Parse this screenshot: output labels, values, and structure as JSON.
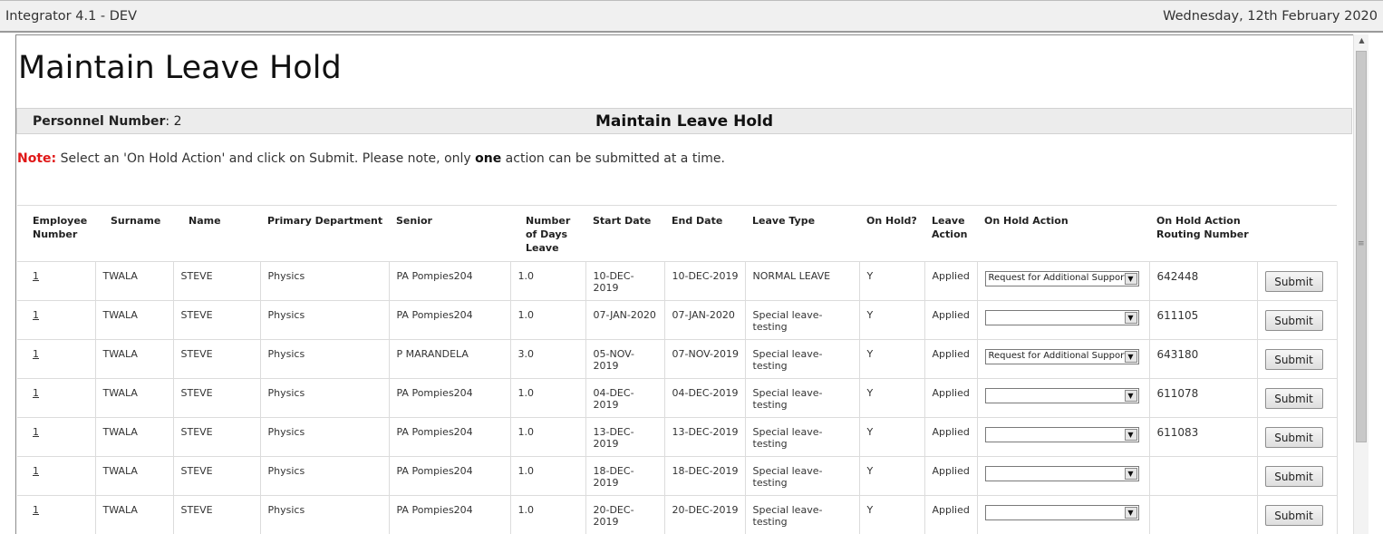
{
  "window": {
    "app_title": "Integrator 4.1 - DEV",
    "date": "Wednesday, 12th February 2020"
  },
  "page": {
    "title": "Maintain Leave Hold",
    "personnel_label": "Personnel Number",
    "personnel_value": ": 2",
    "section_title": "Maintain Leave Hold",
    "note_label": "Note:",
    "note_text_1": " Select an 'On Hold Action' and click on Submit. Please note, only ",
    "note_bold": "one",
    "note_text_2": " action can be submitted at a time."
  },
  "table": {
    "headers": {
      "emp": "Employee Number",
      "surname": "Surname",
      "name": "Name",
      "dept": "Primary Department",
      "senior": "Senior",
      "days": "Number of Days Leave",
      "start": "Start Date",
      "end": "End Date",
      "type": "Leave Type",
      "hold": "On Hold?",
      "action": "Leave Action",
      "hold_action": "On Hold Action",
      "routing": "On Hold Action Routing Number"
    },
    "submit_label": "Submit",
    "rows": [
      {
        "emp": "1",
        "surname": "TWALA",
        "name": "STEVE",
        "dept": "Physics",
        "senior": "PA Pompies204",
        "days": "1.0",
        "start": "10-DEC-2019",
        "end": "10-DEC-2019",
        "type": "NORMAL LEAVE",
        "hold": "Y",
        "action": "Applied",
        "hold_action": "Request for Additional Support",
        "routing": "642448"
      },
      {
        "emp": "1",
        "surname": "TWALA",
        "name": "STEVE",
        "dept": "Physics",
        "senior": "PA Pompies204",
        "days": "1.0",
        "start": "07-JAN-2020",
        "end": "07-JAN-2020",
        "type": "Special leave-testing",
        "hold": "Y",
        "action": "Applied",
        "hold_action": "",
        "routing": "611105"
      },
      {
        "emp": "1",
        "surname": "TWALA",
        "name": "STEVE",
        "dept": "Physics",
        "senior": "P MARANDELA",
        "days": "3.0",
        "start": "05-NOV-2019",
        "end": "07-NOV-2019",
        "type": "Special leave-testing",
        "hold": "Y",
        "action": "Applied",
        "hold_action": "Request for Additional Support",
        "routing": "643180"
      },
      {
        "emp": "1",
        "surname": "TWALA",
        "name": "STEVE",
        "dept": "Physics",
        "senior": "PA Pompies204",
        "days": "1.0",
        "start": "04-DEC-2019",
        "end": "04-DEC-2019",
        "type": "Special leave-testing",
        "hold": "Y",
        "action": "Applied",
        "hold_action": "",
        "routing": "611078"
      },
      {
        "emp": "1",
        "surname": "TWALA",
        "name": "STEVE",
        "dept": "Physics",
        "senior": "PA Pompies204",
        "days": "1.0",
        "start": "13-DEC-2019",
        "end": "13-DEC-2019",
        "type": "Special leave-testing",
        "hold": "Y",
        "action": "Applied",
        "hold_action": "",
        "routing": "611083"
      },
      {
        "emp": "1",
        "surname": "TWALA",
        "name": "STEVE",
        "dept": "Physics",
        "senior": "PA Pompies204",
        "days": "1.0",
        "start": "18-DEC-2019",
        "end": "18-DEC-2019",
        "type": "Special leave-testing",
        "hold": "Y",
        "action": "Applied",
        "hold_action": "",
        "routing": ""
      },
      {
        "emp": "1",
        "surname": "TWALA",
        "name": "STEVE",
        "dept": "Physics",
        "senior": "PA Pompies204",
        "days": "1.0",
        "start": "20-DEC-2019",
        "end": "20-DEC-2019",
        "type": "Special leave-testing",
        "hold": "Y",
        "action": "Applied",
        "hold_action": "",
        "routing": ""
      }
    ]
  }
}
